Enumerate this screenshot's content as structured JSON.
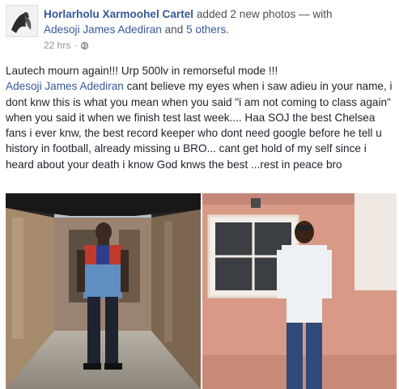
{
  "post": {
    "author": "Horlarholu Xarmoohel Cartel",
    "action_text": " added 2 new photos — with",
    "tagged_person": "Adesoji James Adediran",
    "and_text": " and ",
    "others_link": "5 others",
    "period": ".",
    "timestamp": "22 hrs",
    "separator": "·",
    "privacy_icon": "globe-icon",
    "text_line1": "Lautech mourn again!!! Urp 500lv in remorseful mode !!!",
    "mention": "Adesoji James Adediran",
    "text_body": " cant believe my eyes when i saw adieu in your name, i dont knw this is what you mean when you said \"i am not coming to class again\" when you said it when we finish test last week.... Haa SOJ the best Chelsea fans i ever knw, the best record keeper who dont need google before he tell u history in football, already missing u BRO... cant get hold of my self since i heard about your death i know God knws the best ...rest in peace bro"
  },
  "colors": {
    "link": "#365899",
    "text": "#1d2129",
    "meta": "#90949c"
  }
}
